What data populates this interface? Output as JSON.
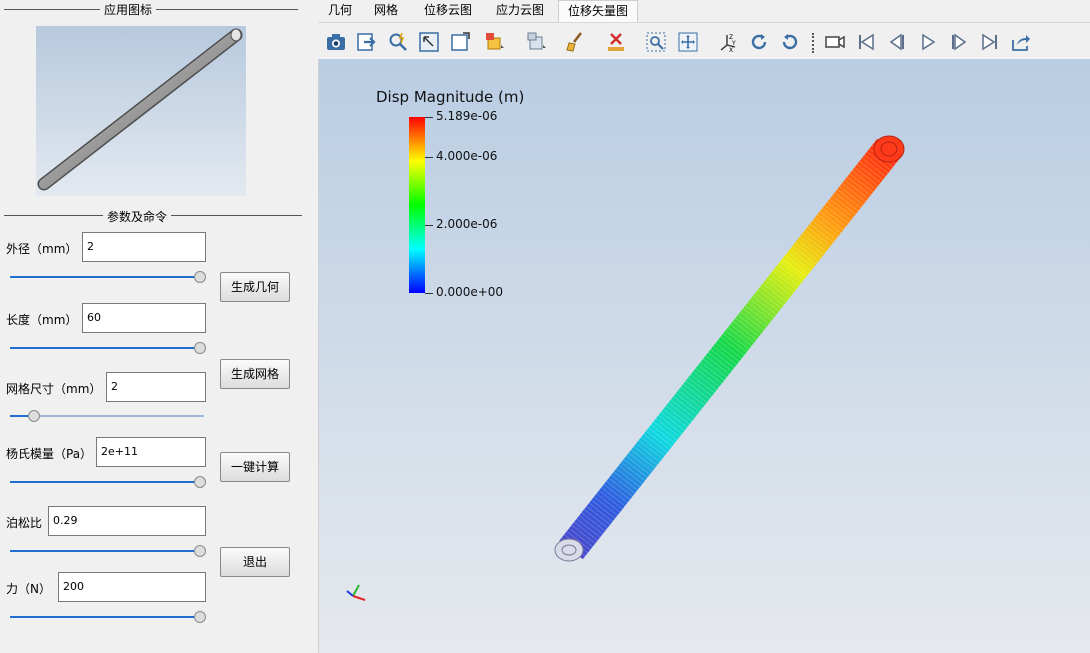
{
  "left_panel": {
    "app_icon_group_title": "应用图标",
    "params_group_title": "参数及命令",
    "params": [
      {
        "label": "外径（mm）",
        "value": "2",
        "slider_fraction": 1.0
      },
      {
        "label": "长度（mm）",
        "value": "60",
        "slider_fraction": 1.0
      },
      {
        "label": "网格尺寸（mm）",
        "value": "2",
        "slider_fraction": 0.1
      },
      {
        "label": "杨氏模量（Pa）",
        "value": "2e+11",
        "slider_fraction": 1.0
      },
      {
        "label": "泊松比",
        "value": "0.29",
        "slider_fraction": 1.0
      },
      {
        "label": "力（N）",
        "value": "200",
        "slider_fraction": 1.0
      }
    ],
    "buttons": {
      "generate_geometry": "生成几何",
      "generate_mesh": "生成网格",
      "compute": "一键计算",
      "exit": "退出"
    }
  },
  "tabs": [
    {
      "label": "几何",
      "active": false
    },
    {
      "label": "网格",
      "active": false
    },
    {
      "label": "位移云图",
      "active": false
    },
    {
      "label": "应力云图",
      "active": false
    },
    {
      "label": "位移矢量图",
      "active": true
    }
  ],
  "toolbar": {
    "icons": [
      "camera-icon",
      "export-icon",
      "query-icon",
      "select-icon",
      "window-icon",
      "add-block-icon",
      "render-icon",
      "clear-brush-icon",
      "delete-icon",
      "zoom-box-icon",
      "zoom-fit-icon",
      "axes-icon",
      "rotate-cw-icon",
      "rotate-ccw-icon",
      "video-icon",
      "first-frame-icon",
      "prev-frame-icon",
      "play-icon",
      "next-frame-icon",
      "last-frame-icon",
      "export-share-icon"
    ]
  },
  "viewport": {
    "colors": {
      "bg_top": "#b9cde3",
      "bg_bottom": "#e6e9ee"
    }
  },
  "chart_data": {
    "type": "heatmap",
    "title": "Disp Magnitude (m)",
    "colorbar_range": [
      0,
      5.189e-06
    ],
    "colorbar_ticks": [
      {
        "value": 5.189e-06,
        "label": "5.189e-06"
      },
      {
        "value": 4e-06,
        "label": "4.000e-06"
      },
      {
        "value": 2e-06,
        "label": "2.000e-06"
      },
      {
        "value": 0.0,
        "label": "0.000e+00"
      }
    ],
    "colormap": [
      "#0000ff",
      "#00ffff",
      "#00ff00",
      "#ffff00",
      "#ff0000"
    ]
  }
}
